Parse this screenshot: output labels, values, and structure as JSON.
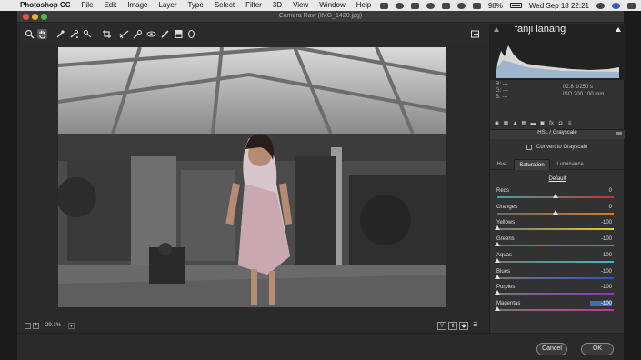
{
  "menubar": {
    "app_name": "Photoshop CC",
    "items": [
      "File",
      "Edit",
      "Image",
      "Layer",
      "Type",
      "Select",
      "Filter",
      "3D",
      "View",
      "Window",
      "Help"
    ],
    "battery": "98%",
    "datetime": "Wed Sep 18  22:21"
  },
  "window": {
    "title": "Camera Raw (IMG_1420.jpg)"
  },
  "toolbar": {
    "tools": [
      "zoom-tool-icon",
      "hand-tool-icon",
      "white-balance-icon",
      "color-sampler-icon",
      "targeted-adjust-icon",
      "crop-icon",
      "straighten-icon",
      "spot-removal-icon",
      "red-eye-icon",
      "adjustment-brush-icon",
      "graduated-filter-icon",
      "radial-filter-icon"
    ],
    "export_icon": "open-preferences-icon"
  },
  "histogram": {
    "watermark": "fanji lanang"
  },
  "info": {
    "r": "R:   ---",
    "g": "G:   ---",
    "b": "B:   ---",
    "aperture_shutter": "f/2.8   1/250 s",
    "iso_focal": "ISO 200   100 mm"
  },
  "panel": {
    "section_title": "HSL / Grayscale",
    "convert_label": "Convert to Grayscale",
    "subtabs": [
      "Hue",
      "Saturation",
      "Luminance"
    ],
    "active_subtab": "Saturation",
    "default_label": "Default",
    "sliders": [
      {
        "label": "Reds",
        "value": "0",
        "level": 0,
        "colors": [
          "#3aa6a6",
          "#d03030"
        ]
      },
      {
        "label": "Oranges",
        "value": "0",
        "level": 0,
        "colors": [
          "#6a6a6a",
          "#e07a20"
        ]
      },
      {
        "label": "Yellows",
        "value": "-100",
        "level": -100,
        "colors": [
          "#777777",
          "#e0d020"
        ]
      },
      {
        "label": "Greens",
        "value": "-100",
        "level": -100,
        "colors": [
          "#777777",
          "#30c030"
        ]
      },
      {
        "label": "Aquas",
        "value": "-100",
        "level": -100,
        "colors": [
          "#777777",
          "#30c0c0"
        ]
      },
      {
        "label": "Blues",
        "value": "-100",
        "level": -100,
        "colors": [
          "#777777",
          "#3050e0"
        ]
      },
      {
        "label": "Purples",
        "value": "-100",
        "level": -100,
        "colors": [
          "#777777",
          "#9030d0"
        ]
      },
      {
        "label": "Magentas",
        "value": "-100",
        "level": -100,
        "colors": [
          "#777777",
          "#d030a0"
        ],
        "selected": true
      }
    ]
  },
  "status": {
    "zoom": "29.1%"
  },
  "buttons": {
    "cancel": "Cancel",
    "ok": "OK"
  }
}
